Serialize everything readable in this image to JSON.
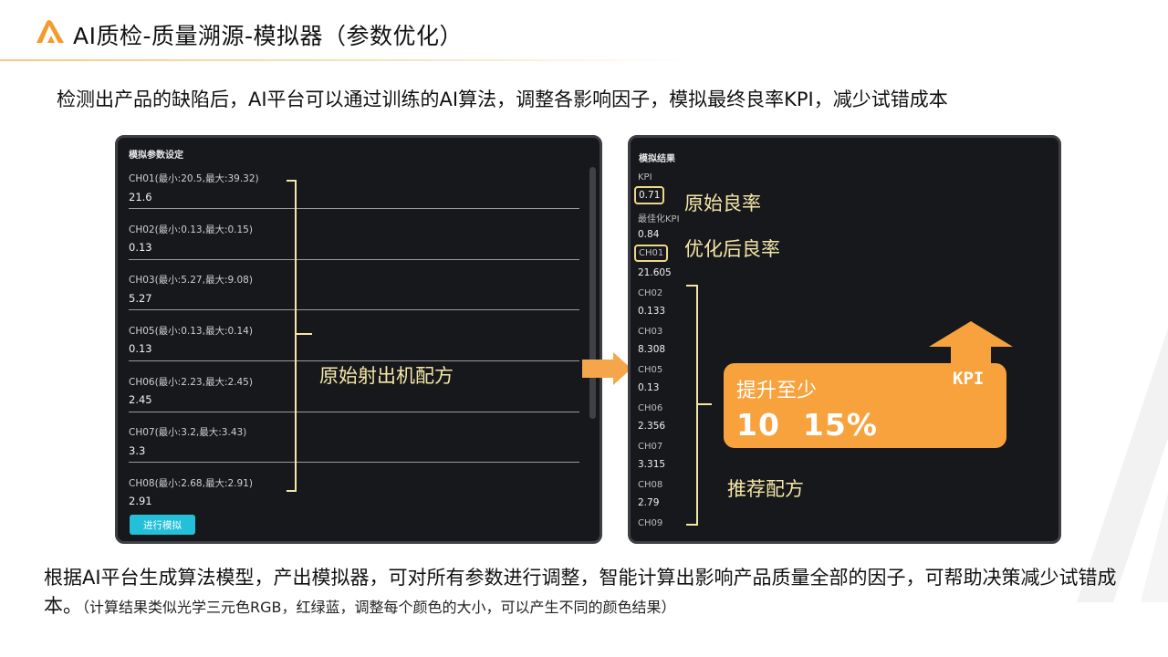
{
  "header": {
    "title": "AI质检-质量溯源-模拟器（参数优化）",
    "subtitle": "检测出产品的缺陷后，AI平台可以通过训练的AI算法，调整各影响因子，模拟最终良率KPI，减少试错成本",
    "accent": "#f39c2b"
  },
  "left_panel": {
    "title": "模拟参数设定",
    "params": [
      {
        "label": "CH01(最小:20.5,最大:39.32)",
        "value": "21.6"
      },
      {
        "label": "CH02(最小:0.13,最大:0.15)",
        "value": "0.13"
      },
      {
        "label": "CH03(最小:5.27,最大:9.08)",
        "value": "5.27"
      },
      {
        "label": "CH05(最小:0.13,最大:0.14)",
        "value": "0.13"
      },
      {
        "label": "CH06(最小:2.23,最大:2.45)",
        "value": "2.45"
      },
      {
        "label": "CH07(最小:3.2,最大:3.43)",
        "value": "3.3"
      },
      {
        "label": "CH08(最小:2.68,最大:2.91)",
        "value": "2.91"
      }
    ],
    "run_button": "进行模拟",
    "annotation": "原始射出机配方"
  },
  "right_panel": {
    "title": "模拟结果",
    "items": [
      {
        "label": "KPI",
        "value": "0.71"
      },
      {
        "label": "最佳化KPI",
        "value": "0.84"
      },
      {
        "label": "CH01",
        "value": "21.605"
      },
      {
        "label": "CH02",
        "value": "0.133"
      },
      {
        "label": "CH03",
        "value": "8.308"
      },
      {
        "label": "CH05",
        "value": "0.13"
      },
      {
        "label": "CH06",
        "value": "2.356"
      },
      {
        "label": "CH07",
        "value": "3.315"
      },
      {
        "label": "CH08",
        "value": "2.79"
      },
      {
        "label": "CH09",
        "value": ""
      }
    ],
    "annotation_original": "原始良率",
    "annotation_optimized": "优化后良率",
    "annotation_recommended": "推荐配方"
  },
  "callout": {
    "title": "提升至少",
    "value": "10  15%",
    "badge": "KPI",
    "color": "#f7a23c"
  },
  "footer": {
    "text": "根据AI平台生成算法模型，产出模拟器，可对所有参数进行调整，智能计算出影响产品质量全部的因子，可帮助决策减少试错成本。",
    "note": "（计算结果类似光学三元色RGB，红绿蓝，调整每个颜色的大小，可以产生不同的颜色结果）"
  }
}
